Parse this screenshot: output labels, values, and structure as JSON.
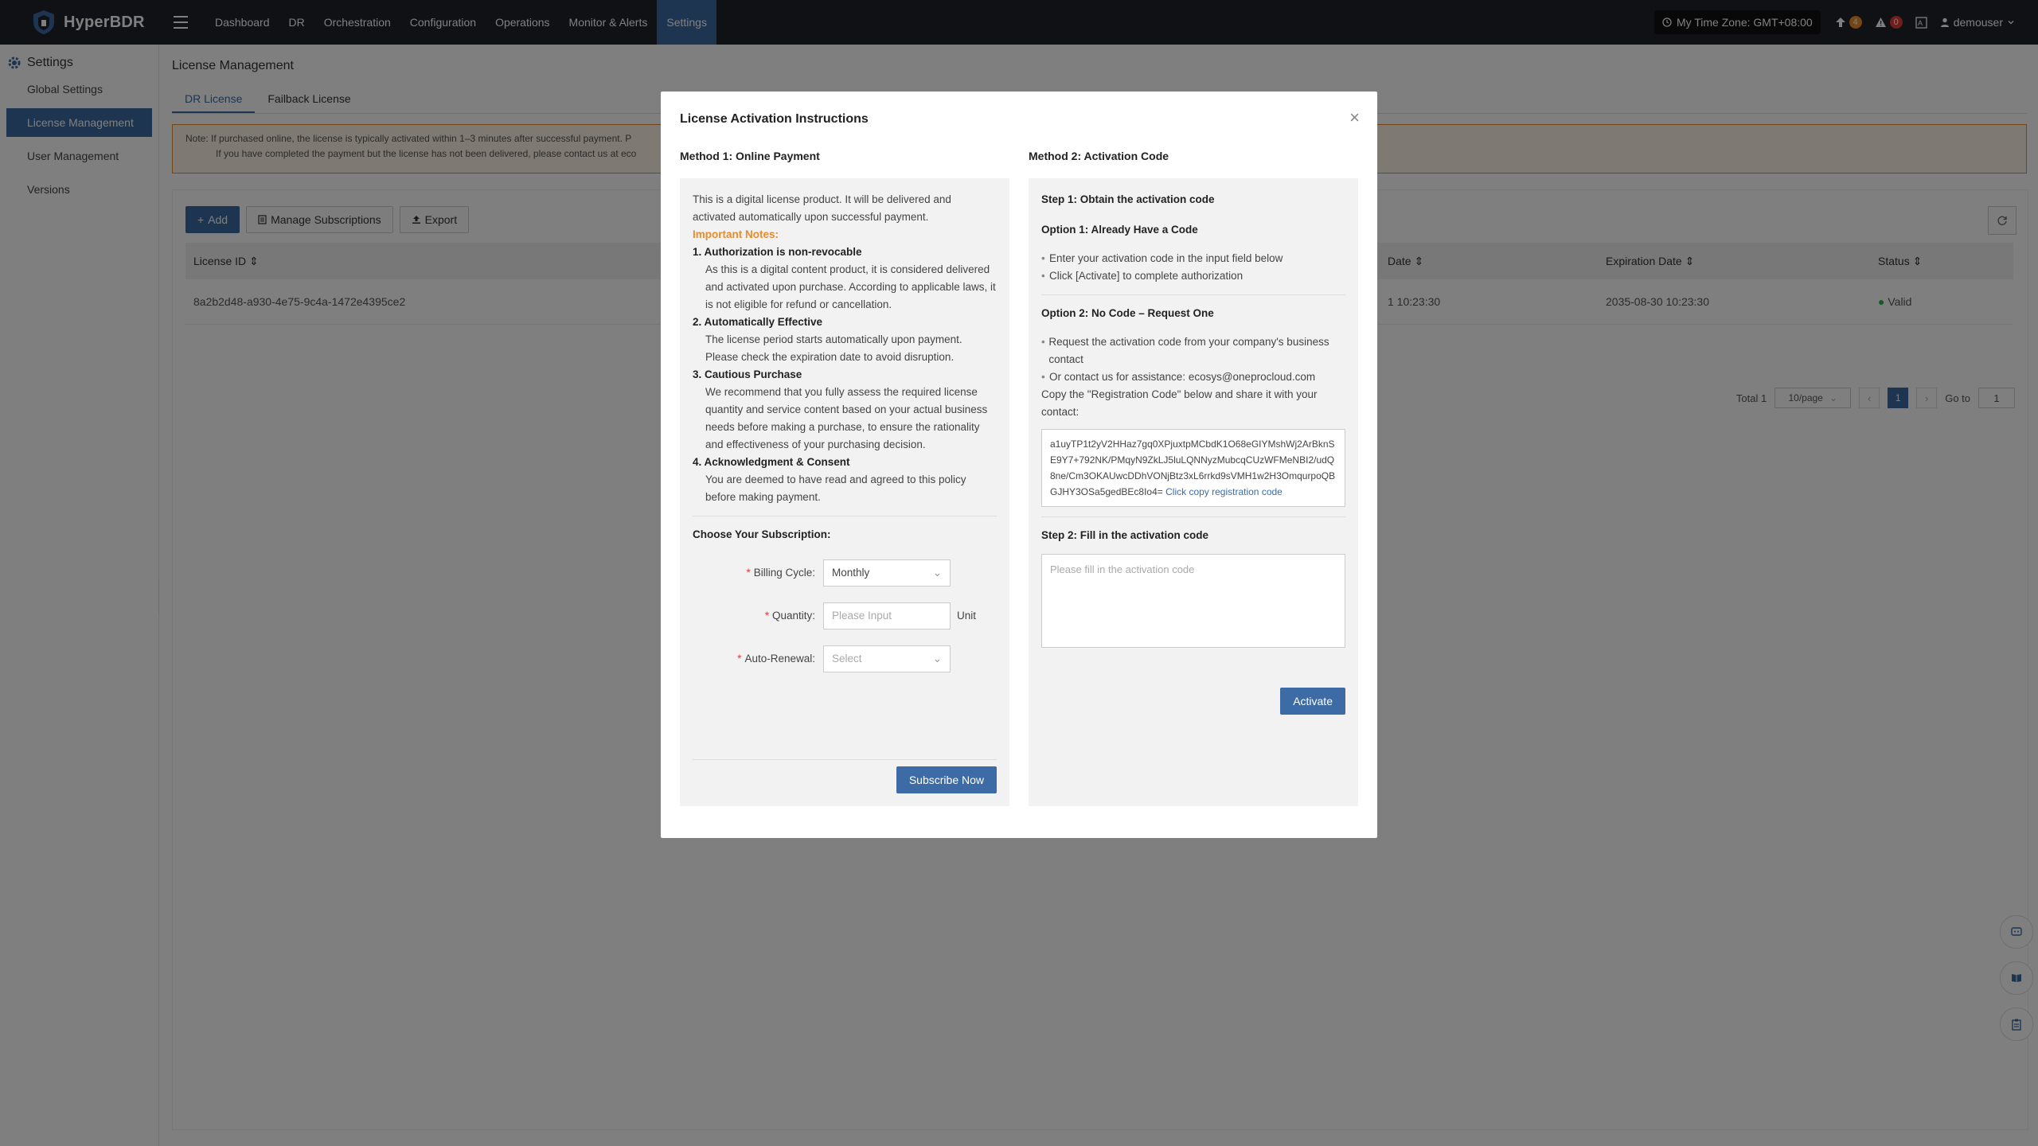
{
  "app": {
    "name": "HyperBDR"
  },
  "nav": {
    "items": [
      "Dashboard",
      "DR",
      "Orchestration",
      "Configuration",
      "Operations",
      "Monitor & Alerts",
      "Settings"
    ],
    "active": "Settings"
  },
  "topbar": {
    "timezone": "My Time Zone: GMT+08:00",
    "task_count": "4",
    "alert_count": "0",
    "username": "demouser"
  },
  "sidebar": {
    "title": "Settings",
    "items": [
      {
        "label": "Global Settings"
      },
      {
        "label": "License Management"
      },
      {
        "label": "User Management"
      },
      {
        "label": "Versions"
      }
    ]
  },
  "page": {
    "title": "License Management",
    "tabs": [
      "DR License",
      "Failback License"
    ],
    "note_line1": "Note: If purchased online, the license is typically activated within 1–3 minutes after successful payment. P",
    "note_line2": "If you have completed the payment but the license has not been delivered, please contact us at eco"
  },
  "toolbar": {
    "add": "Add",
    "manage": "Manage Subscriptions",
    "export": "Export"
  },
  "table": {
    "headers": [
      "License ID",
      "Date",
      "Expiration Date",
      "Status"
    ],
    "rows": [
      {
        "id": "8a2b2d48-a930-4e75-9c4a-1472e4395ce2",
        "date": "1 10:23:30",
        "expiration": "2035-08-30 10:23:30",
        "status": "Valid"
      }
    ]
  },
  "pagination": {
    "total": "Total 1",
    "page_size": "10/page",
    "current": "1",
    "goto_label": "Go to",
    "goto_value": "1"
  },
  "modal": {
    "title": "License Activation Instructions",
    "method1": {
      "title": "Method 1: Online Payment",
      "intro": "This is a digital license product. It will be delivered and activated automatically upon successful payment.",
      "notes_title": "Important Notes:",
      "notes": [
        {
          "title": "1. Authorization is non-revocable",
          "body": "As this is a digital content product, it is considered delivered and activated upon purchase. According to applicable laws, it is not eligible for refund or cancellation."
        },
        {
          "title": "2. Automatically Effective",
          "body": "The license period starts automatically upon payment. Please check the expiration date to avoid disruption."
        },
        {
          "title": "3. Cautious Purchase",
          "body": "We recommend that you fully assess the required license quantity and service content based on your actual business needs before making a purchase, to ensure the rationality and effectiveness of your purchasing decision."
        },
        {
          "title": "4. Acknowledgment & Consent",
          "body": "You are deemed to have read and agreed to this policy before making payment."
        }
      ],
      "choose_title": "Choose Your Subscription:",
      "billing_label": "Billing Cycle:",
      "billing_value": "Monthly",
      "quantity_label": "Quantity:",
      "quantity_placeholder": "Please Input",
      "quantity_unit": "Unit",
      "autorenew_label": "Auto-Renewal:",
      "autorenew_placeholder": "Select",
      "subscribe": "Subscribe Now"
    },
    "method2": {
      "title": "Method 2: Activation Code",
      "step1": "Step 1: Obtain the activation code",
      "opt1_title": "Option 1: Already Have a Code",
      "opt1_items": [
        "Enter your activation code in the input field below",
        "Click [Activate] to complete authorization"
      ],
      "opt2_title": "Option 2: No Code – Request One",
      "opt2_items": [
        "Request the activation code from your company's business contact",
        "Or contact us for assistance: ecosys@oneprocloud.com"
      ],
      "copy_text": "Copy the \"Registration Code\" below and share it with your contact:",
      "reg_code": "a1uyTP1t2yV2HHaz7gq0XPjuxtpMCbdK1O68eGIYMshWj2ArBknSE9Y7+792NK/PMqyN9ZkLJ5luLQNNyzMubcqCUzWFMeNBI2/udQ8ne/Cm3OKAUwcDDhVONjBtz3xL6rrkd9sVMH1w2H3OmqurpoQBGJHY3OSa5gedBEc8Io4=",
      "reg_link": "Click copy registration code",
      "step2": "Step 2: Fill in the activation code",
      "code_placeholder": "Please fill in the activation code",
      "activate": "Activate"
    }
  },
  "colors": {
    "primary": "#3c6ba5",
    "warning": "#e98b2a",
    "danger": "#e23b3b",
    "topbar": "#1f2329"
  }
}
